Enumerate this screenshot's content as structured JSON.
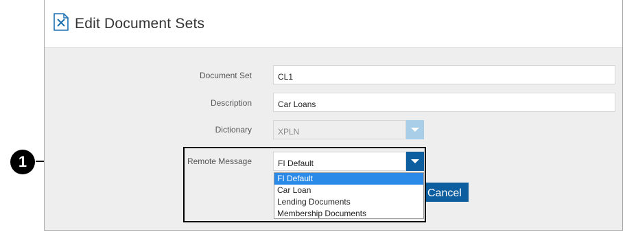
{
  "dialog": {
    "title": "Edit Document Sets",
    "icon": "document-edit-icon"
  },
  "form": {
    "document_set": {
      "label": "Document Set",
      "value": "CL1"
    },
    "description": {
      "label": "Description",
      "value": "Car Loans"
    },
    "dictionary": {
      "label": "Dictionary",
      "value": "XPLN",
      "disabled": true
    },
    "remote_message": {
      "label": "Remote Message",
      "value": "FI Default",
      "options": [
        "FI Default",
        "Car Loan",
        "Lending Documents",
        "Membership Documents"
      ]
    }
  },
  "buttons": {
    "cancel_label": "Cancel"
  },
  "callout": {
    "number": "1"
  },
  "colors": {
    "primary": "#0d5e9f",
    "selected_option": "#2b8ae8",
    "disabled_button": "#a9cfe8",
    "panel_background": "#eeeeee"
  }
}
